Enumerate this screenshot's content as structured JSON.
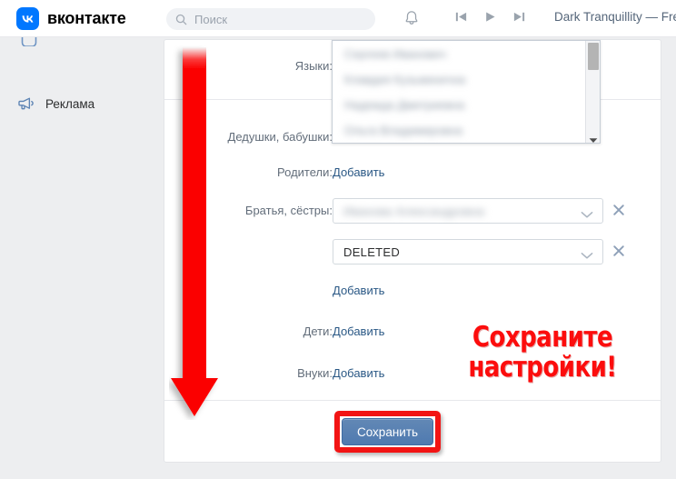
{
  "topbar": {
    "brand": "вконтакте",
    "brand_mark": "vk-logo",
    "search": {
      "placeholder": "Поиск",
      "value": "",
      "icon": "search-icon"
    },
    "notifications_icon": "bell-icon",
    "media": {
      "prev_icon": "skip-previous-icon",
      "play_icon": "play-icon",
      "next_icon": "skip-next-icon",
      "now_playing": "Dark Tranquillity — FreeCa"
    }
  },
  "sidebar": {
    "items": [
      {
        "label": "Реклама",
        "icon": "megaphone-icon"
      }
    ]
  },
  "form": {
    "rows": [
      {
        "label": "Языки:",
        "type": "dropdown-open"
      },
      {
        "label": "Дедушки, бабушки:",
        "type": "dropdown-target"
      },
      {
        "label": "Родители:",
        "action": "Добавить"
      },
      {
        "label": "Братья, сёстры:",
        "type": "select",
        "value": "",
        "blurred": true
      },
      {
        "label": "",
        "type": "select",
        "value": "DELETED",
        "blurred": false
      },
      {
        "label": "",
        "action": "Добавить"
      },
      {
        "label": "Дети:",
        "action": "Добавить"
      },
      {
        "label": "Внуки:",
        "action": "Добавить"
      }
    ],
    "dropdown": {
      "items": [
        "",
        "",
        "",
        ""
      ],
      "scroll_icon": "scrollbar-thumb",
      "arrow_icon": "chevron-down-icon"
    },
    "select_chevron_icon": "chevron-down-icon",
    "remove_icon": "close-icon",
    "save_label": "Сохранить"
  },
  "annotation": {
    "callout_line1": "Сохраните",
    "callout_line2": "настройки!",
    "arrow_icon": "down-arrow-icon",
    "highlight_color": "#f21414",
    "callout_color": "#fc0d0d"
  }
}
